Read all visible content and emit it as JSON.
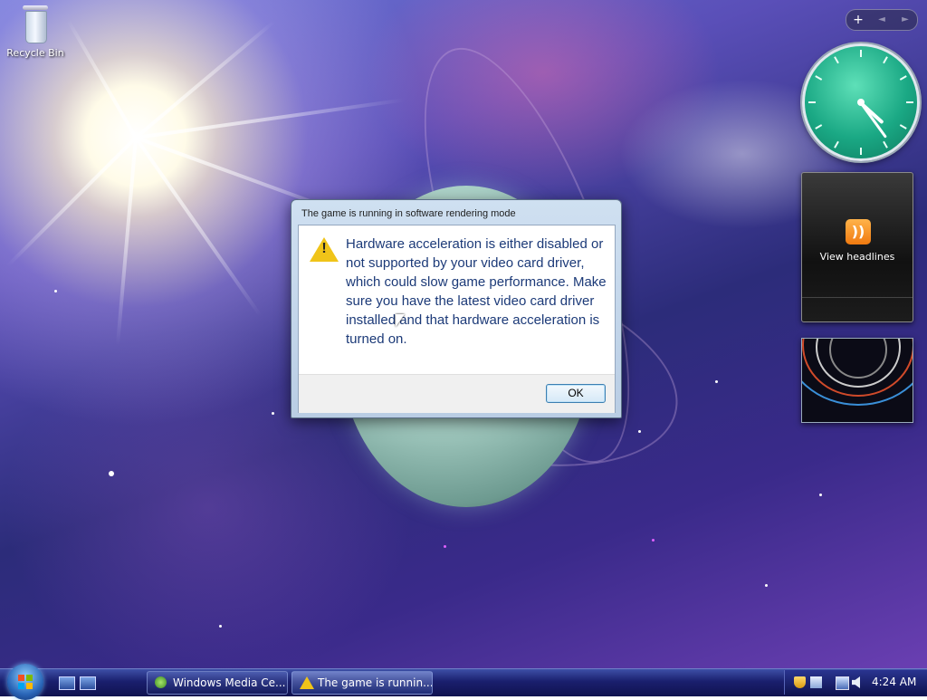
{
  "desktop": {
    "icons": [
      {
        "label": "Recycle Bin",
        "icon": "recycle-bin-icon"
      }
    ]
  },
  "sidebar": {
    "toolbar": {
      "add": "+",
      "prev": "◄",
      "next": "►"
    },
    "clock_time": "4:24",
    "headlines_gadget": {
      "label": "View headlines",
      "icon": "rss-feed-icon",
      "icon_color": "#f5891f"
    },
    "slideshow_gadget": {
      "icon": "slideshow-image"
    }
  },
  "dialog": {
    "title": "The game is running in software rendering mode",
    "icon": "warning-icon",
    "message": "Hardware acceleration is either disabled or not supported by your video card driver, which could slow game performance. Make sure you have the latest video card driver installed and that hardware acceleration is turned on.",
    "ok_label": "OK"
  },
  "taskbar": {
    "start_icon": "windows-start-orb",
    "quick_launch": [
      "show-desktop-icon",
      "switch-windows-icon"
    ],
    "buttons": [
      {
        "label": "Windows Media Ce...",
        "icon": "windows-media-center-icon"
      },
      {
        "label": "The game is runnin...",
        "icon": "warning-icon"
      }
    ],
    "tray": {
      "icons": [
        "security-shield-icon",
        "windows-update-icon",
        "network-icon",
        "volume-icon"
      ],
      "time": "4:24 AM"
    }
  },
  "colors": {
    "dialog_text": "#1c3a78",
    "clock_face": "#1aa884",
    "taskbar": "#1a1f6e"
  }
}
